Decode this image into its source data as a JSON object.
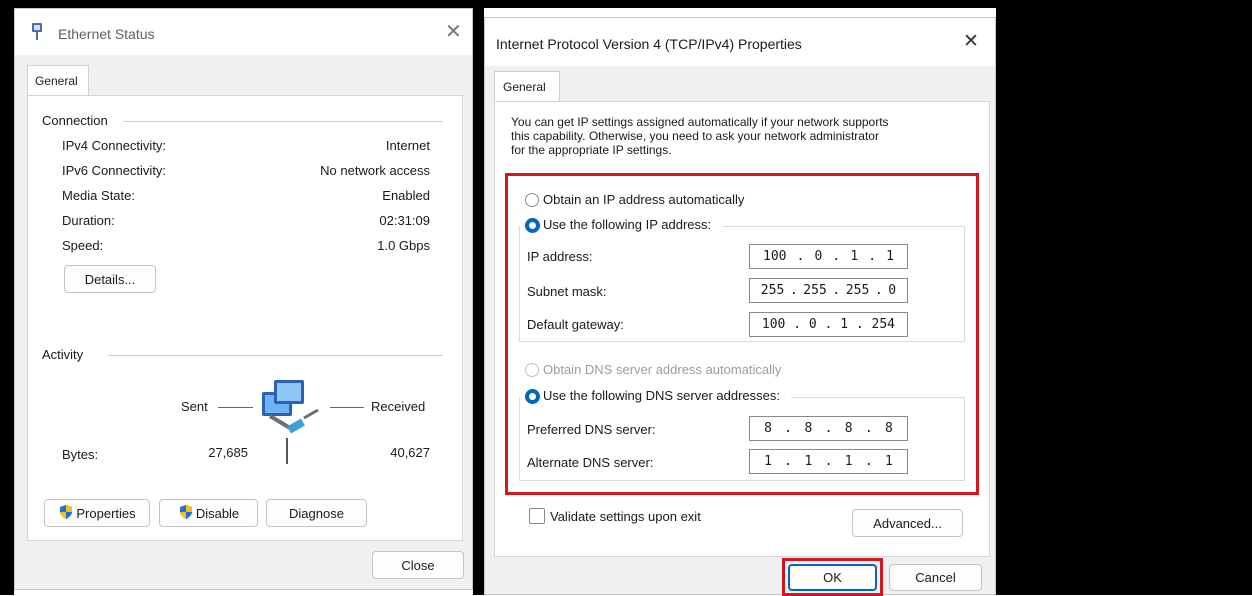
{
  "ethernet_status": {
    "title": "Ethernet Status",
    "tab": "General",
    "connection_label": "Connection",
    "rows": [
      {
        "label": "IPv4 Connectivity:",
        "value": "Internet"
      },
      {
        "label": "IPv6 Connectivity:",
        "value": "No network access"
      },
      {
        "label": "Media State:",
        "value": "Enabled"
      },
      {
        "label": "Duration:",
        "value": "02:31:09"
      },
      {
        "label": "Speed:",
        "value": "1.0 Gbps"
      }
    ],
    "details_button": "Details...",
    "activity_label": "Activity",
    "sent_label": "Sent",
    "received_label": "Received",
    "bytes_label": "Bytes:",
    "bytes_sent": "27,685",
    "bytes_received": "40,627",
    "properties_button": "Properties",
    "disable_button": "Disable",
    "diagnose_button": "Diagnose",
    "close_button": "Close"
  },
  "ipv4_properties": {
    "title": "Internet Protocol Version 4 (TCP/IPv4) Properties",
    "tab": "General",
    "intro_lines": [
      "You can get IP settings assigned automatically if your network supports",
      "this capability. Otherwise, you need to ask your network administrator",
      "for the appropriate IP settings."
    ],
    "obtain_ip_auto": "Obtain an IP address automatically",
    "use_following_ip": "Use the following IP address:",
    "ip_address_label": "IP address:",
    "ip_address": [
      "100",
      "0",
      "1",
      "1"
    ],
    "subnet_label": "Subnet mask:",
    "subnet": [
      "255",
      "255",
      "255",
      "0"
    ],
    "gateway_label": "Default gateway:",
    "gateway": [
      "100",
      "0",
      "1",
      "254"
    ],
    "obtain_dns_auto": "Obtain DNS server address automatically",
    "use_following_dns": "Use the following DNS server addresses:",
    "preferred_dns_label": "Preferred DNS server:",
    "preferred_dns": [
      "8",
      "8",
      "8",
      "8"
    ],
    "alternate_dns_label": "Alternate DNS server:",
    "alternate_dns": [
      "1",
      "1",
      "1",
      "1"
    ],
    "validate_label": "Validate settings upon exit",
    "advanced_button": "Advanced...",
    "ok_button": "OK",
    "cancel_button": "Cancel"
  },
  "colors": {
    "highlight_red": "#d1171f",
    "radio_blue": "#0067c0"
  }
}
